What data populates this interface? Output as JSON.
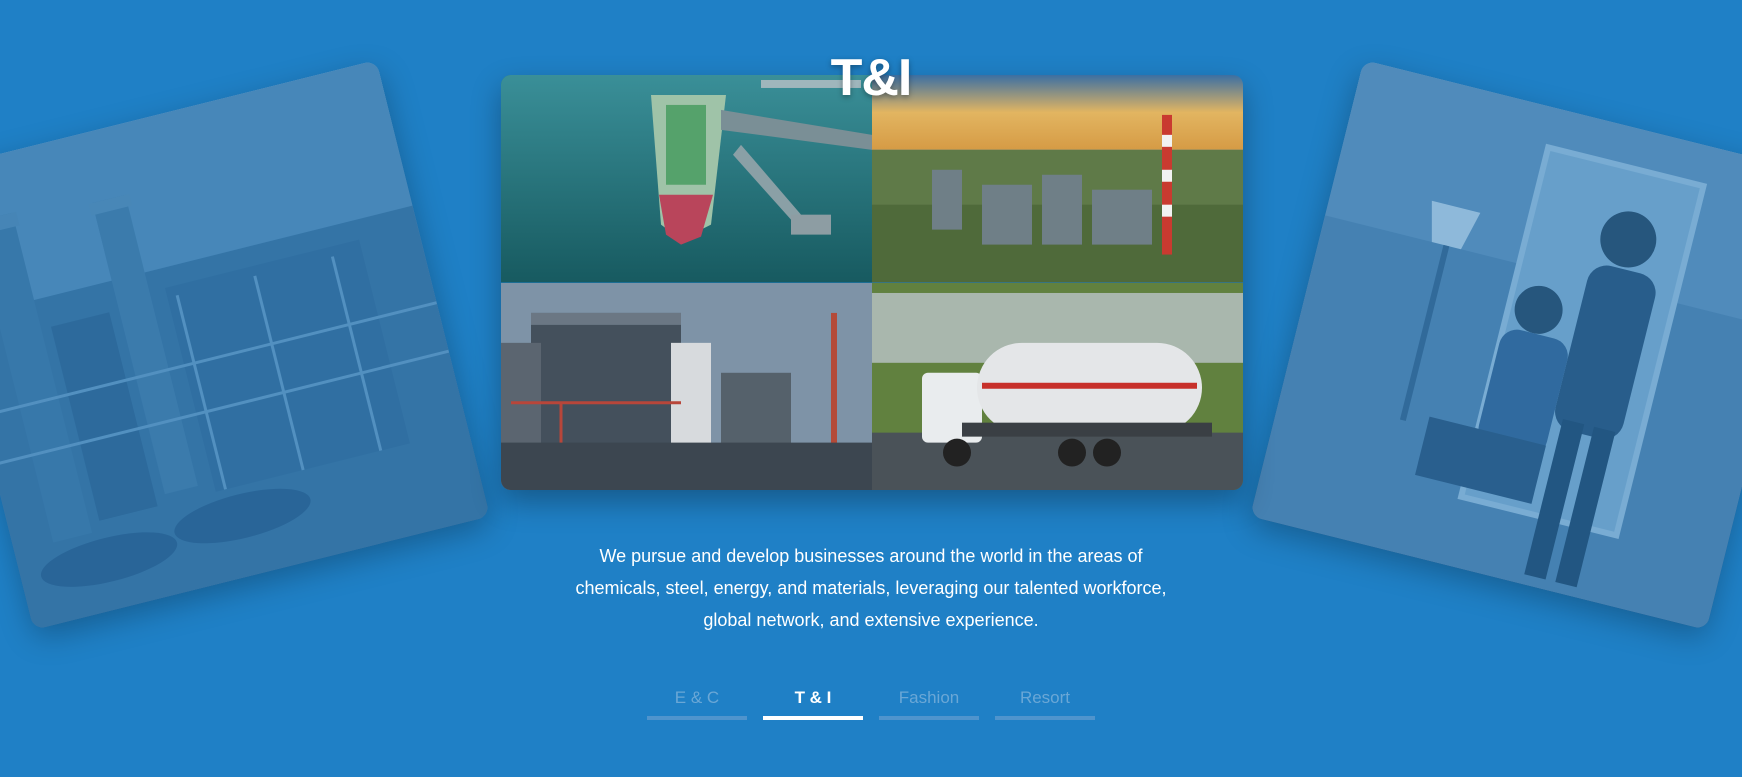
{
  "hero": {
    "title": "T&I"
  },
  "description": {
    "line1": "We pursue and develop businesses around the world in the areas of",
    "line2": "chemicals, steel, energy, and materials, leveraging our talented workforce,",
    "line3": "global network, and extensive experience."
  },
  "tabs": [
    {
      "label": "E & C",
      "active": false
    },
    {
      "label": "T & I",
      "active": true
    },
    {
      "label": "Fashion",
      "active": false
    },
    {
      "label": "Resort",
      "active": false
    }
  ],
  "images": {
    "left_card": "power-plant-photo",
    "right_card": "fashion-models-photo",
    "center_tiles": [
      "tanker-ship-port-photo",
      "refinery-sunset-photo",
      "storage-tanks-photo",
      "tanker-truck-photo"
    ]
  },
  "colors": {
    "background": "#1f80c6",
    "tab_inactive": "#6aa7d6",
    "tab_active": "#ffffff"
  }
}
